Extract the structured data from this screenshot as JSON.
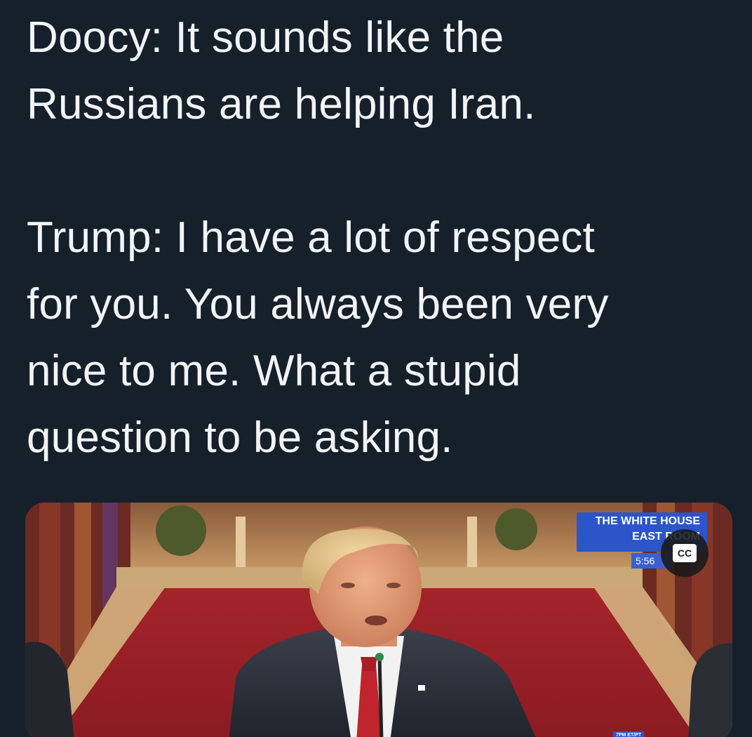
{
  "tweet": {
    "paragraphs": [
      {
        "lines": [
          "Doocy: It sounds like the",
          "Russians are helping Iran."
        ]
      },
      {
        "lines": [
          "Trump: I have a lot of respect",
          "for you. You always been very",
          "nice to me. What a stupid",
          "question to be asking."
        ]
      }
    ]
  },
  "video": {
    "overlay": {
      "line1": "THE WHITE HOUSE",
      "line2": "EAST ROOM",
      "time": "5:56"
    },
    "captions_label": "CC",
    "chyron_tiny": "7PM ET/PT"
  },
  "colors": {
    "background": "#16202b",
    "text": "#f3f4f6",
    "overlay_blue": "#2c55c9"
  }
}
